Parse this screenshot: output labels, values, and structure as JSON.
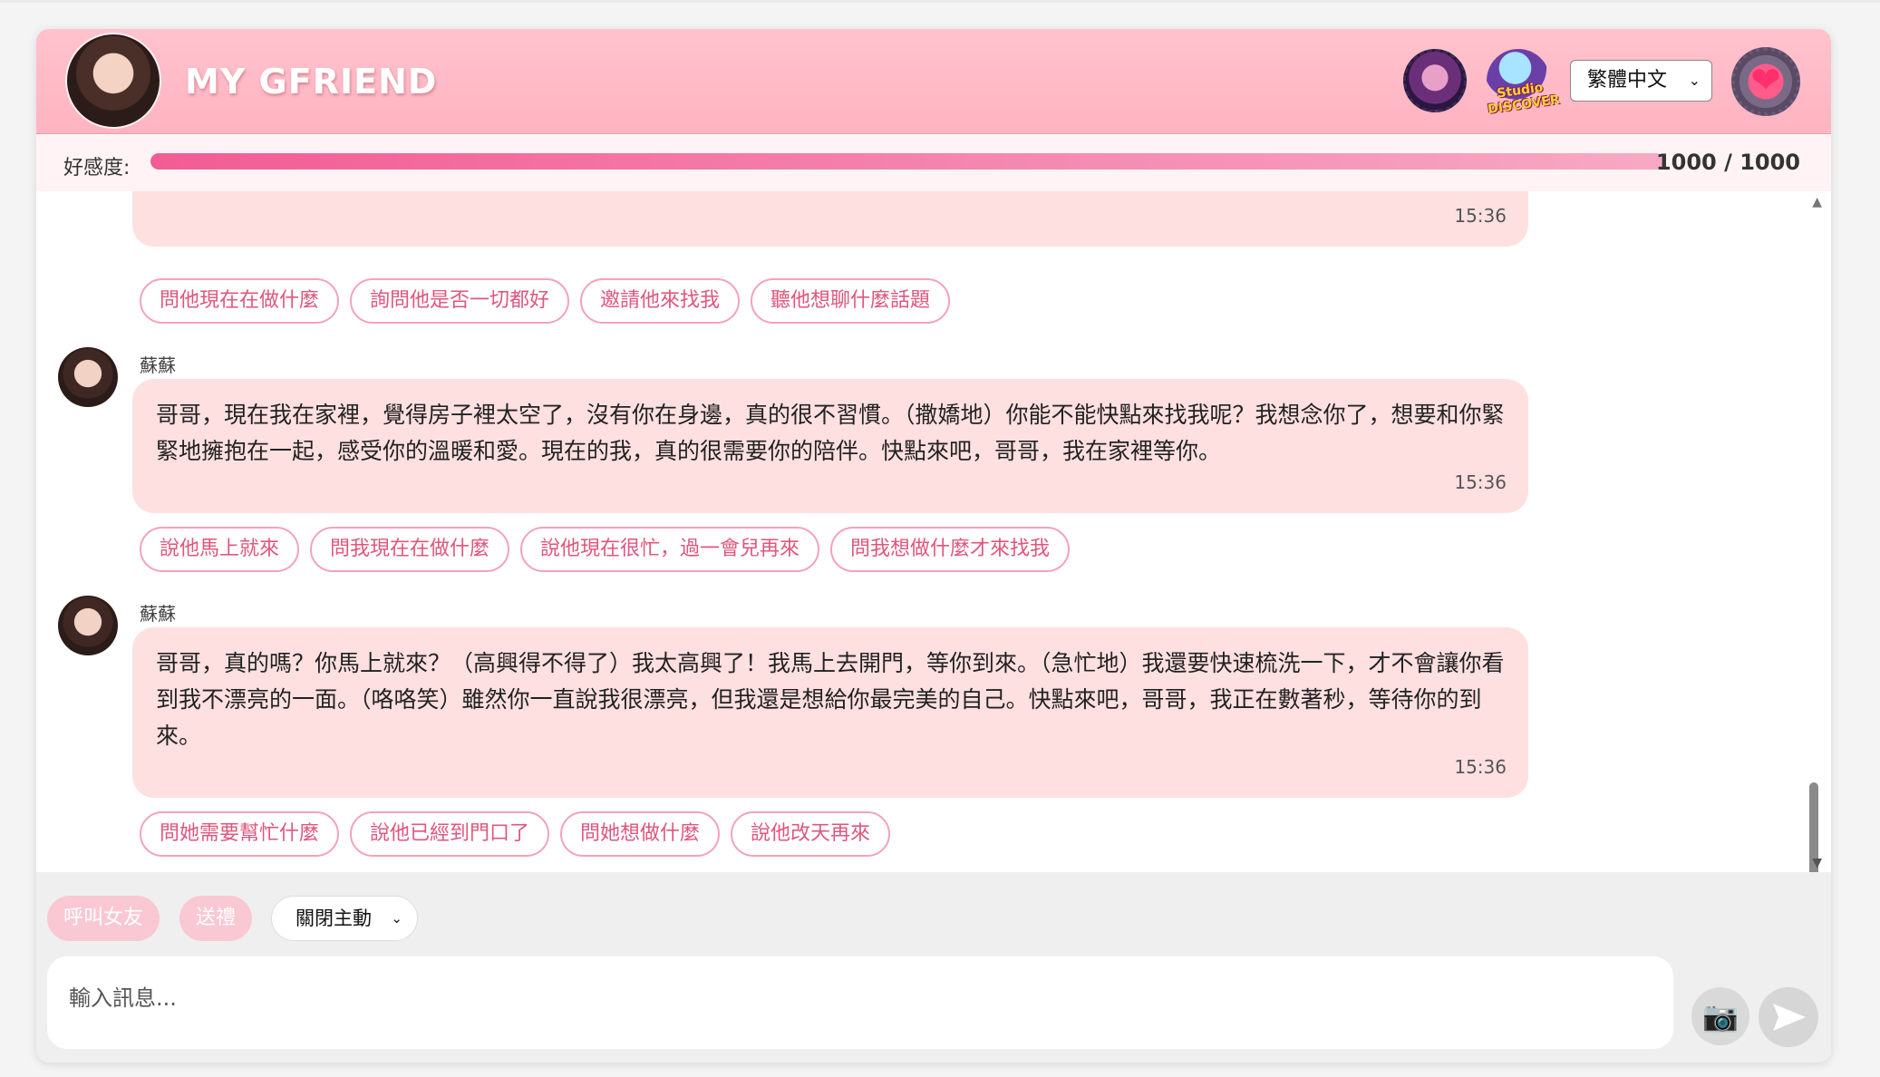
{
  "header": {
    "title": "MY GFRIEND",
    "discover_logo_text": "Studio DISCOVER",
    "language": {
      "selected": "繁體中文"
    },
    "icons": [
      "avatar",
      "gallery-icon",
      "discover-icon",
      "heart-settings-icon"
    ]
  },
  "affinity": {
    "label": "好感度:",
    "value_text": "1000 / 1000",
    "fraction": 1.0
  },
  "messages": [
    {
      "sender": "",
      "text": "",
      "time": "15:36",
      "suggestions": [
        "問他現在在做什麼",
        "詢問他是否一切都好",
        "邀請他來找我",
        "聽他想聊什麼話題"
      ]
    },
    {
      "sender": "蘇蘇",
      "text": "哥哥，現在我在家裡，覺得房子裡太空了，沒有你在身邊，真的很不習慣。（撒嬌地）你能不能快點來找我呢？我想念你了，想要和你緊緊地擁抱在一起，感受你的溫暖和愛。現在的我，真的很需要你的陪伴。快點來吧，哥哥，我在家裡等你。",
      "time": "15:36",
      "suggestions": [
        "說他馬上就來",
        "問我現在在做什麼",
        "說他現在很忙，過一會兒再來",
        "問我想做什麼才來找我"
      ]
    },
    {
      "sender": "蘇蘇",
      "text": "哥哥，真的嗎？你馬上就來？（高興得不得了）我太高興了！我馬上去開門，等你到來。（急忙地）我還要快速梳洗一下，才不會讓你看到我不漂亮的一面。（咯咯笑）雖然你一直說我很漂亮，但我還是想給你最完美的自己。快點來吧，哥哥，我正在數著秒，等待你的到來。",
      "time": "15:36",
      "suggestions": [
        "問她需要幫忙什麼",
        "說他已經到門口了",
        "問她想做什麼",
        "說他改天再來"
      ]
    }
  ],
  "controls": {
    "call_label": "呼叫女友",
    "gift_label": "送禮",
    "proactive": {
      "selected": "關閉主動"
    }
  },
  "composer": {
    "placeholder": "輸入訊息..."
  },
  "colors": {
    "header_bg": "#ffb3c1",
    "accent": "#f25c94",
    "bubble_bg": "#ffe0e1",
    "chip_text": "#e0567c"
  }
}
